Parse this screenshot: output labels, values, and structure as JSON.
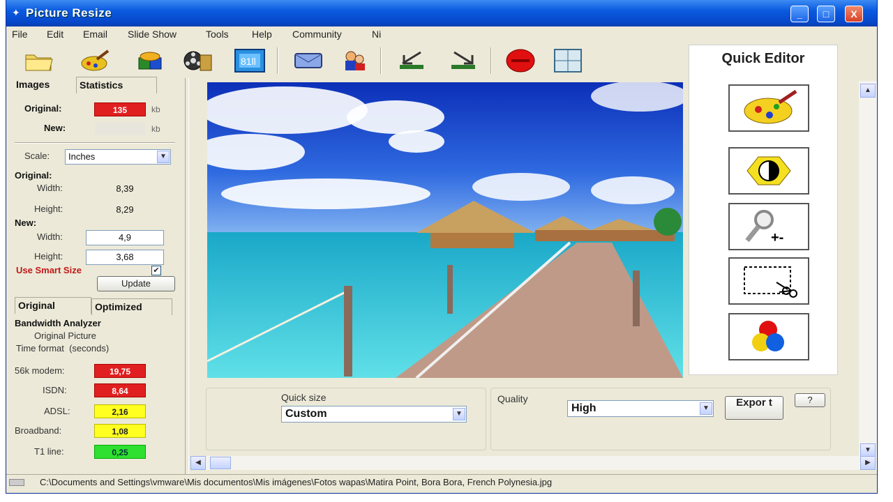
{
  "window": {
    "title": "Picture Resize"
  },
  "title_buttons": {
    "minimize": "_",
    "maximize": "□",
    "close": "X"
  },
  "menu": [
    "File",
    "Edit",
    "Email",
    "Slide Show",
    "Tools",
    "Help",
    "Community",
    "Ni"
  ],
  "toolbar": {
    "items": [
      "open-folder-icon",
      "paint-brush-icon",
      "database-icon",
      "film-reel-icon",
      "slideshow-icon",
      "email-envelope-icon",
      "people-icon",
      "resize-down-icon",
      "resize-up-icon",
      "stop-icon",
      "grid-icon"
    ]
  },
  "left_tabs": {
    "images": "Images",
    "statistics": "Statistics"
  },
  "size_info": {
    "original_label": "Original:",
    "original_value": "135",
    "new_label": "New:",
    "unit": "kb"
  },
  "scale": {
    "label": "Scale:",
    "selected": "Inches"
  },
  "dimensions": {
    "original_label": "Original:",
    "width_label": "Width:",
    "height_label": "Height:",
    "original_width": "8,39",
    "original_height": "8,29",
    "new_label": "New:",
    "new_width": "4,9",
    "new_height": "3,68"
  },
  "smart_size": {
    "label": "Use Smart Size",
    "checked_glyph": "✔"
  },
  "update_button": "Update",
  "bandwidth_tabs": {
    "original": "Original",
    "optimized": "Optimized"
  },
  "bandwidth": {
    "title": "Bandwidth Analyzer",
    "subtitle": "Original Picture",
    "time_format": "Time format  (seconds)",
    "rows": [
      {
        "label": "56k modem:",
        "value": "19,75",
        "color": "red"
      },
      {
        "label": "ISDN:",
        "value": "8,64",
        "color": "red"
      },
      {
        "label": "ADSL:",
        "value": "2,16",
        "color": "yellow"
      },
      {
        "label": "Broadband:",
        "value": "1,08",
        "color": "yellow"
      },
      {
        "label": "T1 line:",
        "value": "0,25",
        "color": "green"
      }
    ]
  },
  "quick_editor": {
    "title": "Quick Editor",
    "tools": [
      "paint-palette-icon",
      "contrast-icon",
      "zoom-icon",
      "crop-scissors-icon",
      "color-balls-icon"
    ]
  },
  "bottom": {
    "quick_size_label": "Quick size",
    "quick_size_value": "Custom",
    "quality_label": "Quality",
    "quality_value": "High",
    "export_button": "Expor t",
    "help_button": "?"
  },
  "status": {
    "path": "C:\\Documents and Settings\\vmware\\Mis documentos\\Mis imágenes\\Fotos wapas\\Matira Point, Bora Bora, French Polynesia.jpg"
  },
  "colors": {
    "title_bar": "#0a5ae0",
    "window_bg": "#ece9d8",
    "alert_red": "#e02020",
    "warn_yellow": "#ffff20",
    "ok_green": "#30e030"
  }
}
